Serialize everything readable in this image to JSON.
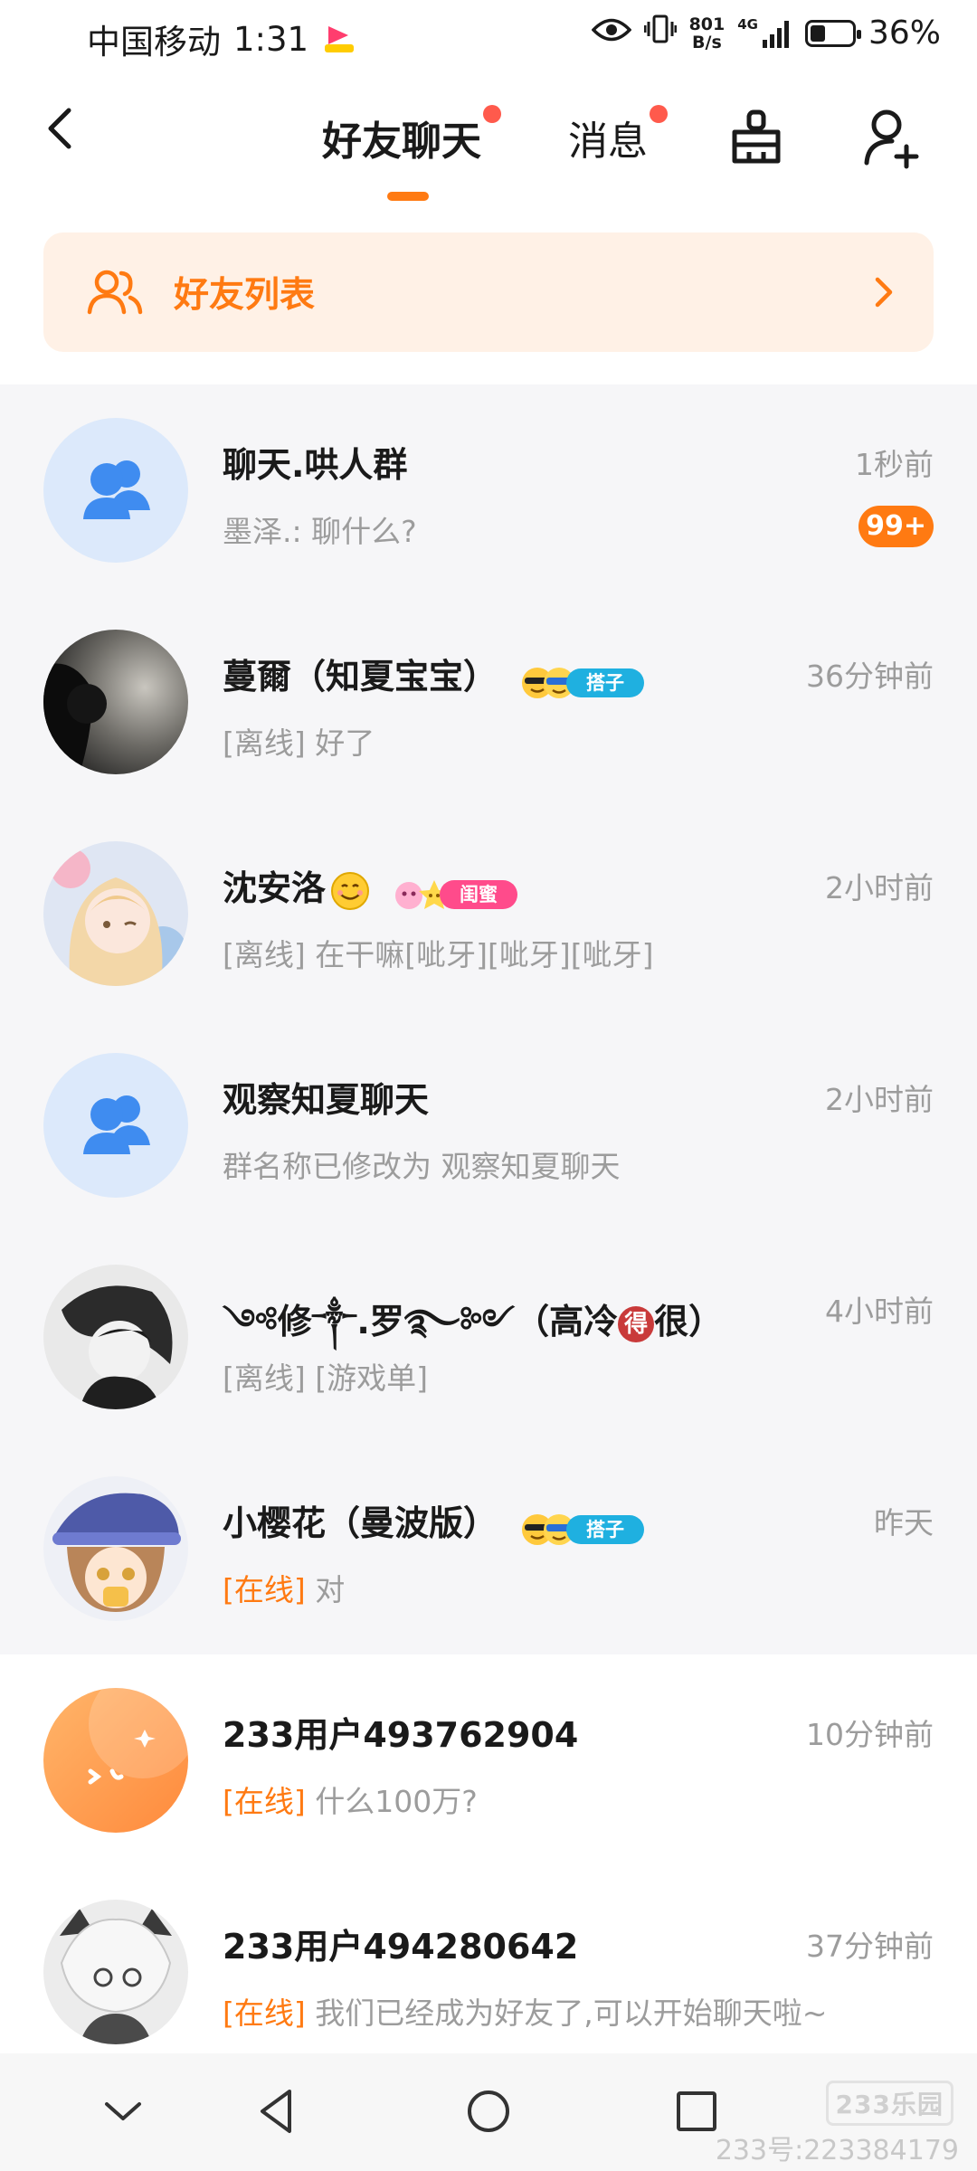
{
  "status_bar": {
    "carrier": "中国移动",
    "time": "1:31",
    "net_speed_value": "801",
    "net_speed_unit": "B/s",
    "net_type": "4G",
    "battery": "36%",
    "battery_level": 0.36
  },
  "header": {
    "tabs": [
      {
        "label": "好友聊天",
        "active": true,
        "has_dot": true
      },
      {
        "label": "消息",
        "active": false,
        "has_dot": true
      }
    ],
    "icons": [
      "back-icon",
      "broom-icon",
      "add-friend-icon"
    ]
  },
  "friend_list_banner": {
    "label": "好友列表"
  },
  "conversations": [
    {
      "name": "聊天.哄人群",
      "time": "1秒前",
      "preview": "墨泽.: 聊什么?",
      "unread": "99+",
      "type": "group",
      "section": "pinned"
    },
    {
      "name": "蔓爾（知夏宝宝）",
      "time": "36分钟前",
      "status": "[离线]",
      "preview": " 好了",
      "tag": "搭子",
      "type": "user",
      "section": "pinned"
    },
    {
      "name": "沈安洛",
      "time": "2小时前",
      "status": "[离线]",
      "preview": " 在干嘛[呲牙][呲牙][呲牙]",
      "tag": "闺蜜",
      "type": "user",
      "section": "pinned"
    },
    {
      "name": "观察知夏聊天",
      "time": "2小时前",
      "preview": "群名称已修改为 观察知夏聊天",
      "type": "group",
      "section": "pinned"
    },
    {
      "name_part1": "༺修༒.罗࿐༻（高冷",
      "name_badge": "得",
      "name_part2": "很）",
      "time": "4小时前",
      "status": "[离线]",
      "preview": " [游戏单]",
      "type": "user",
      "section": "pinned"
    },
    {
      "name": "小樱花（曼波版）",
      "time": "昨天",
      "status": "[在线]",
      "preview": " 对",
      "tag": "搭子",
      "type": "user",
      "section": "pinned"
    },
    {
      "name": "233用户493762904",
      "time": "10分钟前",
      "status": "[在线]",
      "preview": " 什么100万?",
      "type": "user",
      "section": "normal"
    },
    {
      "name": "233用户494280642",
      "time": "37分钟前",
      "status": "[在线]",
      "preview": " 我们已经成为好友了,可以开始聊天啦~",
      "type": "user",
      "section": "normal"
    }
  ],
  "nav_bar": {
    "icons": [
      "collapse-icon",
      "back-triangle-icon",
      "home-circle-icon",
      "recents-square-icon"
    ],
    "watermark_logo": "233乐园",
    "watermark": "233号:223384179"
  },
  "colors": {
    "accent": "#ff7a12",
    "badge_red": "#ff5a4c",
    "tag_blue": "#1fb0e0",
    "tag_pink": "#ff4b8b"
  }
}
